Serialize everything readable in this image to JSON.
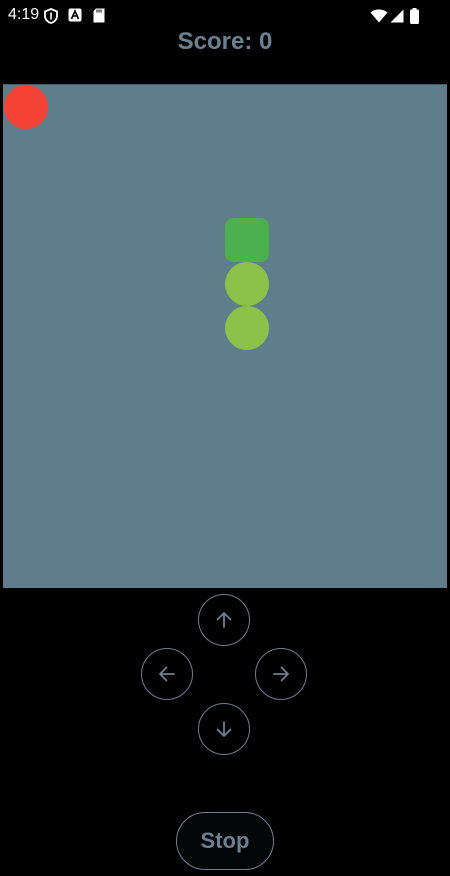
{
  "status_bar": {
    "time": "4:19",
    "left_icons": [
      "shield-icon",
      "a-badge-icon",
      "sd-card-icon"
    ],
    "right_icons": [
      "wifi-icon",
      "signal-icon",
      "battery-icon"
    ]
  },
  "score": {
    "label": "Score: 0",
    "value": 0
  },
  "board": {
    "background": "#607d8b",
    "food_color": "#f44336",
    "snake_head_color": "#4caf50",
    "snake_body_color": "#8bc34a"
  },
  "controls": {
    "up_icon": "arrow-up-icon",
    "left_icon": "arrow-left-icon",
    "right_icon": "arrow-right-icon",
    "down_icon": "arrow-down-icon",
    "stop_label": "Stop",
    "accent": "#6b8192"
  }
}
